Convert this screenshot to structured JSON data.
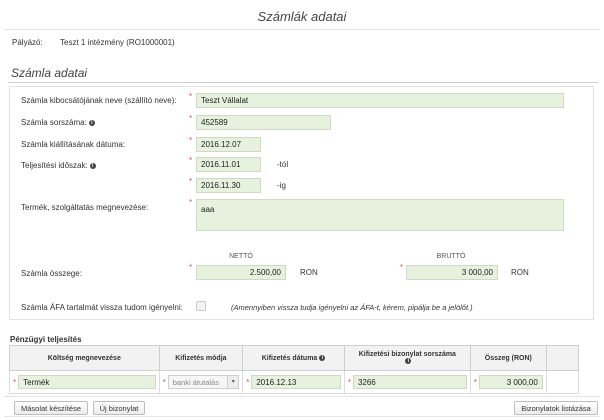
{
  "page": {
    "title": "Számlák adatai"
  },
  "applicant": {
    "label": "Pályázó:",
    "value": "Teszt 1 intézmény (RO1000001)"
  },
  "section": {
    "title": "Számla adatai"
  },
  "form": {
    "issuer_label": "Számla kibocsátójának neve (szállító neve):",
    "issuer_value": "Teszt Vállalat",
    "number_label": "Számla sorszáma:",
    "number_value": "452589",
    "date_label": "Számla kiállításának dátuma:",
    "date_value": "2016.12.07",
    "period_label": "Teljesítési időszak:",
    "period_from": "2016.11.01",
    "period_from_suffix": "-tól",
    "period_to": "2016.11.30",
    "period_to_suffix": "-ig",
    "product_label": "Termék, szolgáltatás megnevezése:",
    "product_value": "aaa",
    "net_header": "NETTÓ",
    "gross_header": "BRUTTÓ",
    "amount_label": "Számla összege:",
    "net_value": "2.500,00",
    "gross_value": "3 000,00",
    "currency": "RON",
    "vat_label": "Számla ÁFA tartalmát vissza tudom igényelni:",
    "vat_hint": "(Amennyiben vissza tudja igényelni az ÁFA-t, kérem, pipálja be a jelölőt.)",
    "vat_checked": false,
    "info_glyph": "i",
    "required_mark": "*"
  },
  "payment": {
    "title": "Pénzügyi teljesítés",
    "headers": [
      "Költség megnevezése",
      "Kifizetés módja",
      "Kifizetés dátuma",
      "Kifizetési bizonylat sorszáma",
      "Összeg (RON)"
    ],
    "row": {
      "cost": "Termék",
      "method": "banki átutalás",
      "date": "2016.12.13",
      "receipt": "3266",
      "amount": "3 000,00"
    }
  },
  "buttons": {
    "copy": "Másolat készítése",
    "new": "Új bizonylat",
    "list": "Bizonylatok listázása"
  },
  "icons": {
    "select_arrow": "▾"
  },
  "colors": {
    "field_bg": "#e6f2dd",
    "required": "#d9534f"
  }
}
